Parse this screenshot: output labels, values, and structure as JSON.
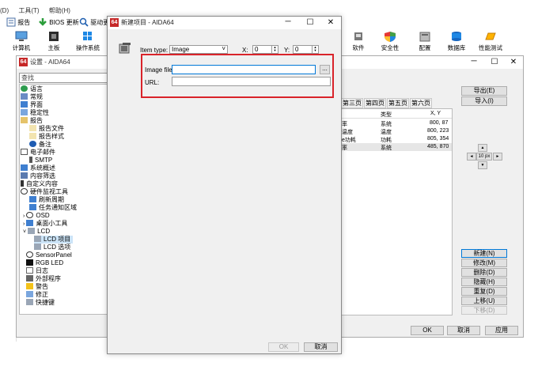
{
  "main_window": {
    "menu": [
      "(D)",
      "工具(T)",
      "帮助(H)"
    ],
    "toolbar1": {
      "report": "报告",
      "bios_update": "BIOS 更新",
      "driver_update": "驱动更"
    },
    "categories": [
      "计算机",
      "主板",
      "操作系统",
      "软件",
      "安全性",
      "配置",
      "数据库",
      "性能测试"
    ]
  },
  "settings_window": {
    "title": "设置 - AIDA64",
    "search_placeholder": "查找",
    "tree": [
      {
        "label": "语言"
      },
      {
        "label": "常规"
      },
      {
        "label": "界面"
      },
      {
        "label": "稳定性"
      },
      {
        "label": "报告"
      },
      {
        "label": "报告文件"
      },
      {
        "label": "报告样式"
      },
      {
        "label": "备注"
      },
      {
        "label": "电子邮件"
      },
      {
        "label": "SMTP"
      },
      {
        "label": "系统概述"
      },
      {
        "label": "内容筛选"
      },
      {
        "label": "自定义内容"
      },
      {
        "label": "硬件监视工具"
      },
      {
        "label": "刷新周期"
      },
      {
        "label": "任务通知区域"
      },
      {
        "label": "OSD"
      },
      {
        "label": "桌面小工具"
      },
      {
        "label": "LCD"
      },
      {
        "label": "LCD 项目"
      },
      {
        "label": "LCD 选项"
      },
      {
        "label": "SensorPanel"
      },
      {
        "label": "RGB LED"
      },
      {
        "label": "日志"
      },
      {
        "label": "外部程序"
      },
      {
        "label": "警告"
      },
      {
        "label": "修正"
      },
      {
        "label": "快捷键"
      }
    ],
    "tabs": [
      "第三页",
      "第四页",
      "第五页",
      "第六页"
    ],
    "table": {
      "headers": [
        "类型",
        "X, Y"
      ],
      "rows": [
        {
          "name": "率",
          "type": "系统",
          "xy": "800, 87"
        },
        {
          "name": "温度",
          "type": "温度",
          "xy": "800, 223"
        },
        {
          "name": "e功耗",
          "type": "功耗",
          "xy": "805, 354"
        },
        {
          "name": "率",
          "type": "系统",
          "xy": "485, 870"
        }
      ]
    },
    "export_label": "导出(E)",
    "import_label": "导入(I)",
    "nudge": {
      "up": "▲",
      "left": "◄",
      "step": "10 px",
      "right": "►",
      "down": "▼"
    },
    "actions": [
      "新建(N)",
      "修改(M)",
      "删除(D)",
      "隐藏(H)",
      "重复(D)",
      "上移(U)",
      "下移(D)"
    ],
    "ok_label": "OK",
    "cancel_label": "取消",
    "apply_label": "应用"
  },
  "dialog": {
    "title": "新建项目 - AIDA64",
    "app_badge": "64",
    "item_type_label": "Item type:",
    "item_type_value": "Image",
    "x_label": "X:",
    "x_value": "0",
    "y_label": "Y:",
    "y_value": "0",
    "image_file_label": "Image file:",
    "image_file_value": "",
    "browse_label": "...",
    "url_label": "URL:",
    "url_value": "",
    "ok_label": "OK",
    "cancel_label": "取消",
    "highlight_color": "#d9232a"
  }
}
